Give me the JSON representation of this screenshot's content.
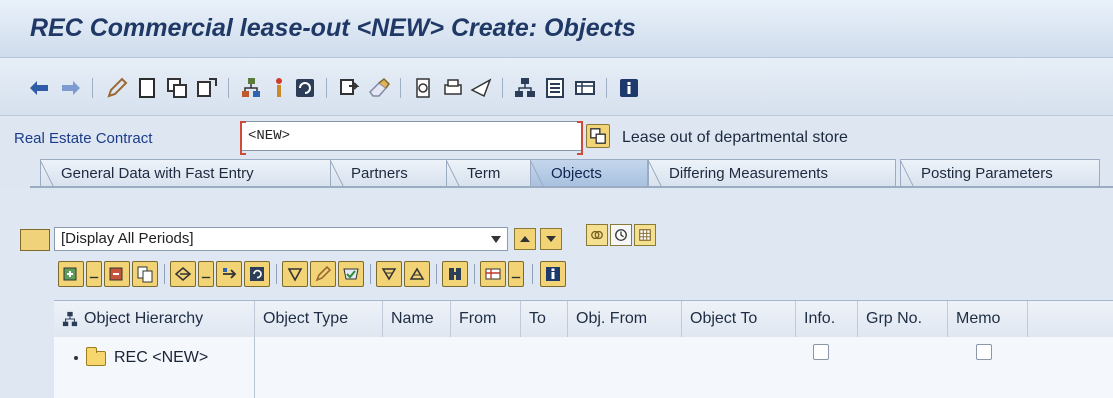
{
  "window": {
    "title": "REC Commercial lease-out <NEW> Create: Objects"
  },
  "toolbar": {
    "icons": [
      "back-arrow-icon",
      "forward-arrow-icon",
      "edit-pencil-icon",
      "new-document-icon",
      "copy-icon",
      "other-object-icon",
      "hierarchy-icon",
      "info-pin-icon",
      "refresh-icon",
      "attachment-icon",
      "eraser-icon",
      "copy-object-icon",
      "print-icon",
      "send-icon",
      "org-structure-icon",
      "list-icon",
      "table-icon",
      "info-icon"
    ]
  },
  "contract": {
    "label": "Real Estate Contract",
    "value": "<NEW>",
    "description": "Lease out of departmental store"
  },
  "tabs": [
    {
      "label": "General Data with Fast Entry",
      "active": false
    },
    {
      "label": "Partners",
      "active": false
    },
    {
      "label": "Term",
      "active": false
    },
    {
      "label": "Objects",
      "active": true
    },
    {
      "label": "Differing Measurements",
      "active": false
    },
    {
      "label": "Posting Parameters",
      "active": false
    }
  ],
  "period": {
    "selected": "[Display All Periods]"
  },
  "grid": {
    "columns": [
      "Object Hierarchy",
      "Object Type",
      "Name",
      "From",
      "To",
      "Obj. From",
      "Object To",
      "Info.",
      "Grp No.",
      "Memo"
    ],
    "rows": [
      {
        "hierarchy": "REC <NEW>",
        "object_type": "",
        "name": "",
        "from": "",
        "to": "",
        "obj_from": "",
        "object_to": "",
        "info_checked": false,
        "grp_no": "",
        "memo_checked": false
      }
    ]
  },
  "colors": {
    "title": "#1f3866",
    "label_blue": "#1b3c8a",
    "button_yellow": "#f2d477",
    "active_tab": "#a9c1df"
  }
}
